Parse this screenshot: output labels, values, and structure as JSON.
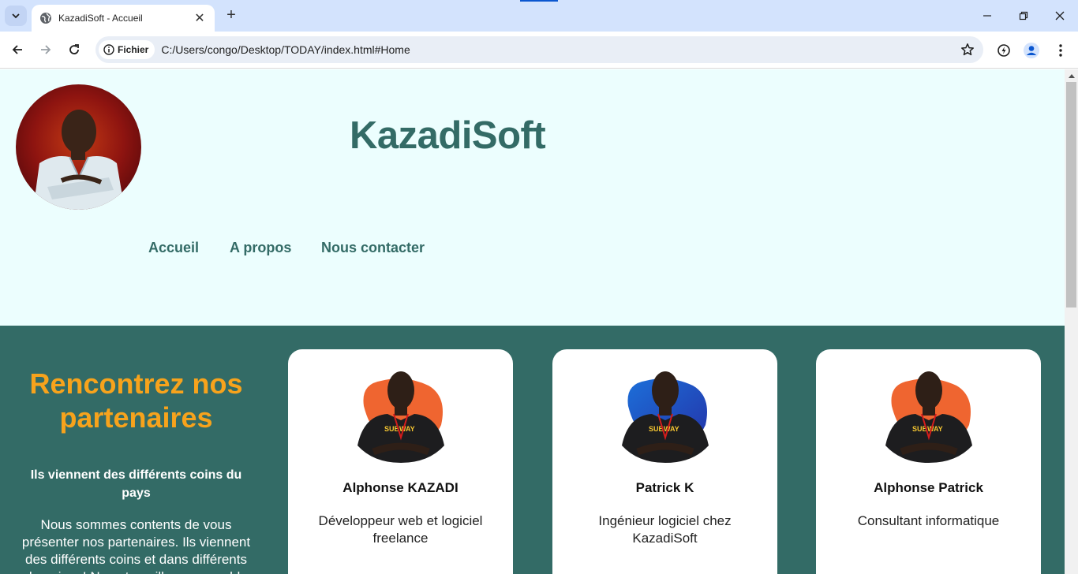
{
  "browser": {
    "tab_title": "KazadiSoft - Accueil",
    "chip_label": "Fichier",
    "url": "C:/Users/congo/Desktop/TODAY/index.html#Home"
  },
  "header": {
    "site_title": "KazadiSoft",
    "menu": [
      "Accueil",
      "A propos",
      "Nous contacter"
    ]
  },
  "team": {
    "title": "Rencontrez nos partenaires",
    "subtitle": "Ils viennent des différents coins du pays",
    "text": "Nous sommes contents de vous présenter nos partenaires. Ils viennent des différents coins et dans différents domaines! Nous travaillons ensemble",
    "cards": [
      {
        "name": "Alphonse KAZADI",
        "role": "Développeur web et logiciel freelance",
        "accent": "#ef6530"
      },
      {
        "name": "Patrick K",
        "role": "Ingénieur logiciel chez KazadiSoft",
        "accent": "#1d5fcf"
      },
      {
        "name": "Alphonse Patrick",
        "role": "Consultant informatique",
        "accent": "#ef6530"
      }
    ]
  },
  "colors": {
    "header_bg": "#ecfefe",
    "brand": "#336b66",
    "accent": "#f7a31c"
  }
}
